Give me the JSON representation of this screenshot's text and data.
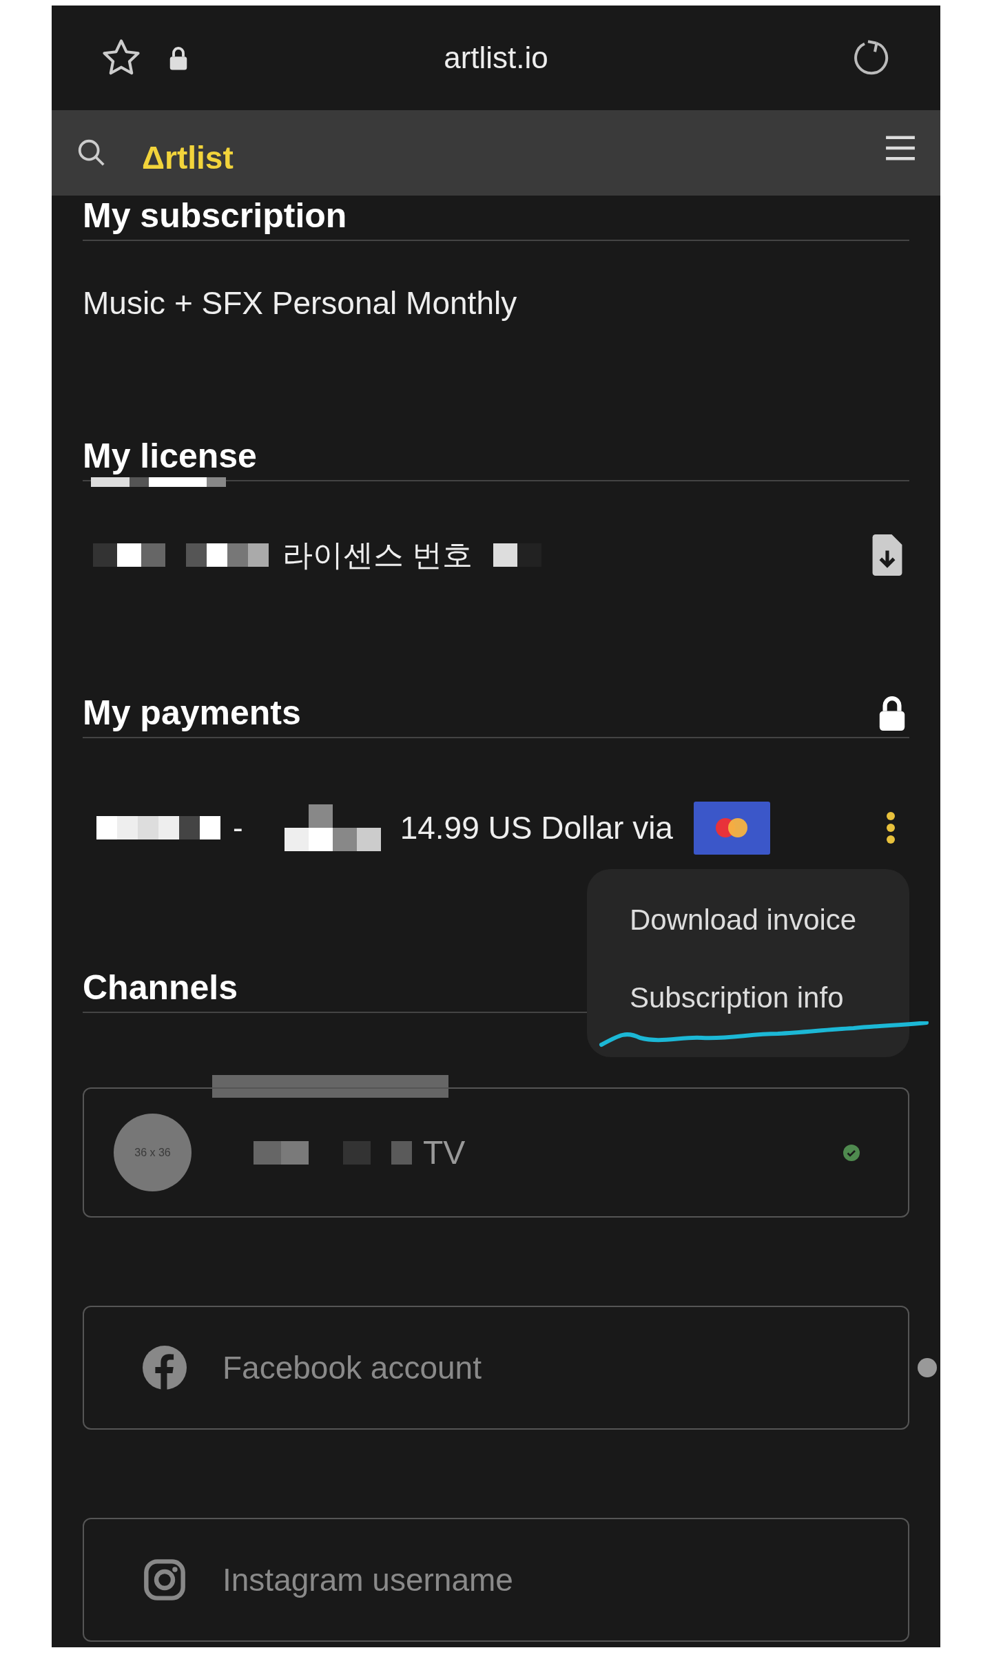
{
  "browser": {
    "url": "artlist.io"
  },
  "nav": {
    "logo": "Δrtlist"
  },
  "subscription": {
    "title": "My subscription",
    "plan": "Music + SFX Personal Monthly"
  },
  "license": {
    "title": "My license",
    "label": "라이센스 번호"
  },
  "payments": {
    "title": "My payments",
    "separator": "-",
    "amount": "14.99 US Dollar via"
  },
  "payment_menu": [
    {
      "label": "Download invoice",
      "highlighted": false
    },
    {
      "label": "Subscription info",
      "highlighted": true
    }
  ],
  "channels": {
    "title": "Channels",
    "items": [
      {
        "kind": "channel",
        "avatar": "36 x 36",
        "name": "TV",
        "verified": true
      },
      {
        "kind": "facebook",
        "placeholder": "Facebook account"
      },
      {
        "kind": "instagram",
        "placeholder": "Instagram username"
      }
    ]
  }
}
